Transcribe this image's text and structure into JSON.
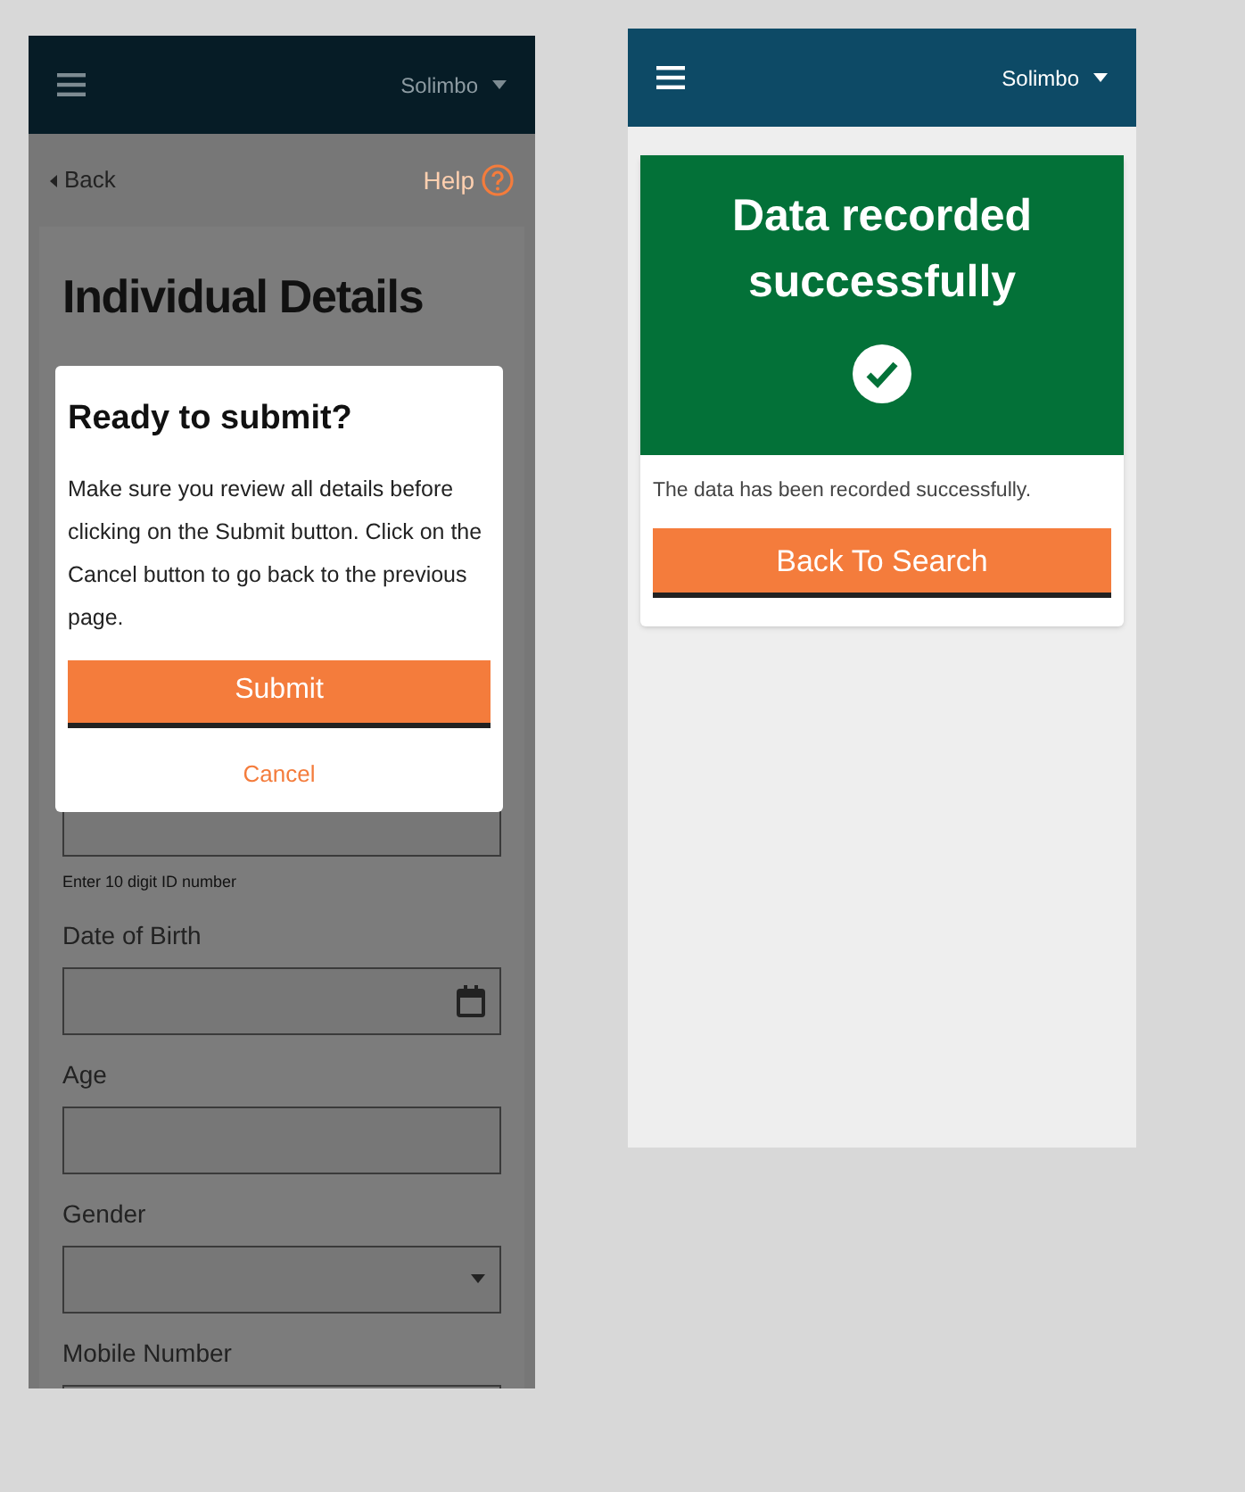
{
  "form_screen": {
    "header": {
      "user": "Solimbo"
    },
    "back": "Back",
    "help": "Help",
    "title": "Individual Details",
    "fields": [
      {
        "kind": "text",
        "helper": "Enter 10 digit ID number"
      },
      {
        "kind": "date",
        "label": "Date of Birth"
      },
      {
        "kind": "text",
        "label": "Age"
      },
      {
        "kind": "select",
        "label": "Gender"
      },
      {
        "kind": "text",
        "label": "Mobile Number"
      }
    ],
    "dialog": {
      "title": "Ready to submit?",
      "message": "Make sure you review all details before clicking on the Submit button. Click on the Cancel button to go back to the previous page.",
      "submit": "Submit",
      "cancel": "Cancel"
    }
  },
  "success_screen": {
    "header": {
      "user": "Solimbo"
    },
    "banner": "Data recorded successfully",
    "message": "The data has been recorded successfully.",
    "button": "Back To Search"
  }
}
